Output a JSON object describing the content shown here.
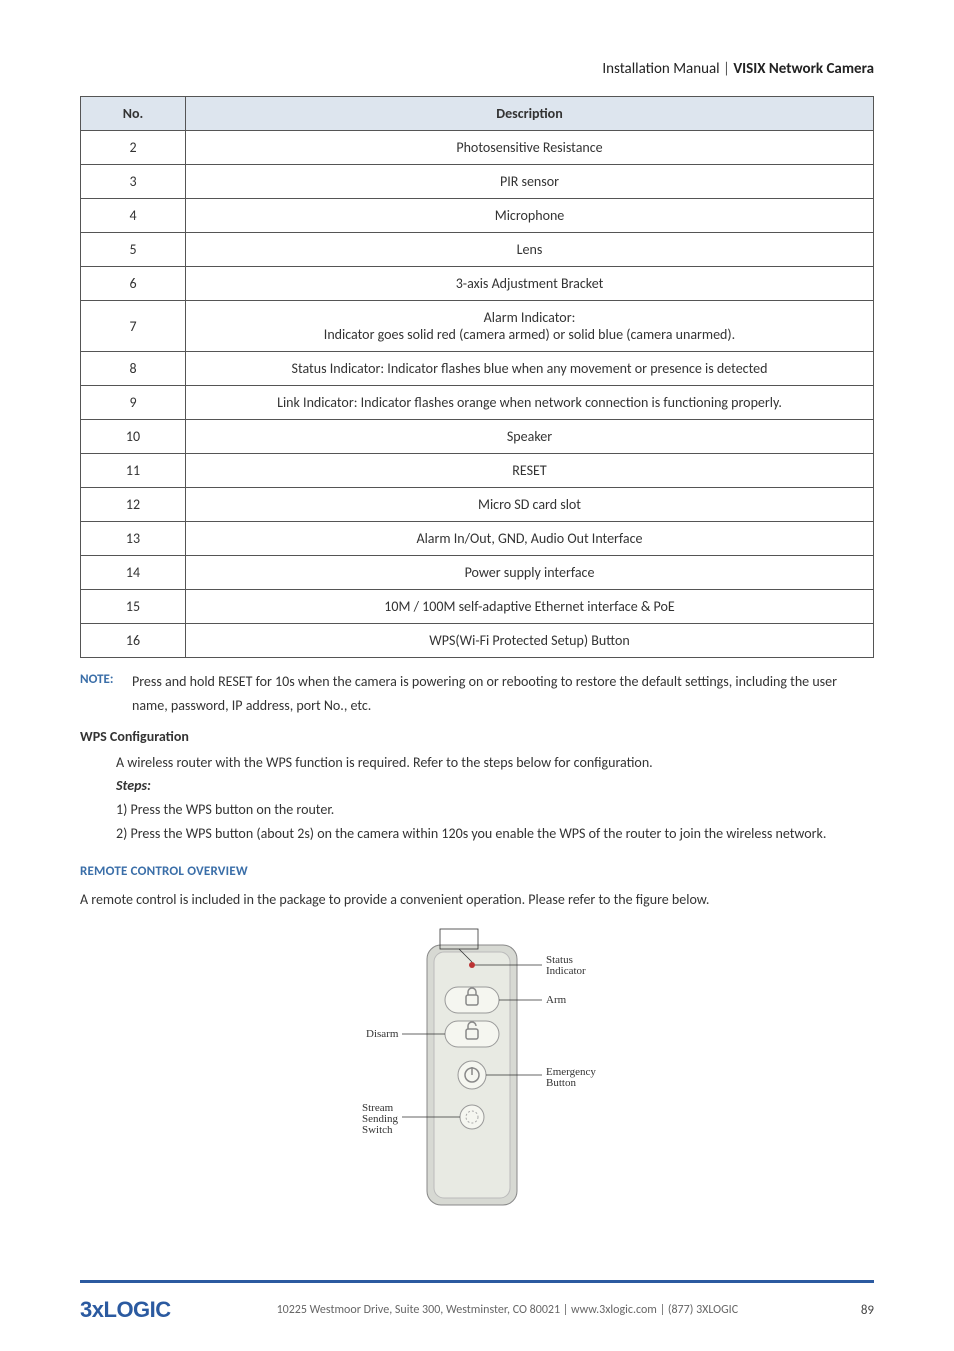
{
  "header": {
    "left": "Installation Manual",
    "divider": " | ",
    "right": "VISIX Network Camera"
  },
  "table": {
    "headers": {
      "no": "No.",
      "desc": "Description"
    },
    "rows": [
      {
        "no": "2",
        "desc": "Photosensitive Resistance"
      },
      {
        "no": "3",
        "desc": "PIR sensor"
      },
      {
        "no": "4",
        "desc": "Microphone"
      },
      {
        "no": "5",
        "desc": "Lens"
      },
      {
        "no": "6",
        "desc": "3-axis Adjustment Bracket"
      },
      {
        "no": "7",
        "desc": "Alarm Indicator:\nIndicator goes solid red (camera armed) or solid blue (camera unarmed)."
      },
      {
        "no": "8",
        "desc": "Status Indicator: Indicator flashes blue when any movement or presence is detected"
      },
      {
        "no": "9",
        "desc": "Link Indicator: Indicator flashes orange when network connection is functioning properly."
      },
      {
        "no": "10",
        "desc": "Speaker"
      },
      {
        "no": "11",
        "desc": "RESET"
      },
      {
        "no": "12",
        "desc": "Micro SD card slot"
      },
      {
        "no": "13",
        "desc": "Alarm In/Out, GND, Audio Out Interface"
      },
      {
        "no": "14",
        "desc": "Power supply interface"
      },
      {
        "no": "15",
        "desc": "10M / 100M self-adaptive Ethernet interface & PoE"
      },
      {
        "no": "16",
        "desc": "WPS(Wi-Fi Protected Setup) Button"
      }
    ]
  },
  "note": {
    "label": "NOTE:",
    "text": "Press and hold RESET for 10s when the camera is powering on or rebooting to restore the default settings, including the user name, password, IP address, port No., etc."
  },
  "wps": {
    "heading": "WPS Configuration",
    "intro": "A wireless router with the WPS function is required. Refer to the steps below for configuration.",
    "steps_label": "Steps:",
    "step1": "1)   Press the WPS button on the router.",
    "step2": "2)   Press the WPS button (about 2s) on the camera within 120s you enable the WPS of the router to join the wireless network."
  },
  "remote": {
    "heading": "REMOTE CONTROL OVERVIEW",
    "intro": "A remote control is included in the package to provide a convenient operation. Please refer to the figure below.",
    "labels": {
      "status": "Status\nIndicator",
      "arm": "Arm",
      "disarm": "Disarm",
      "emergency": "Emergency\nButton",
      "stream": "Stream\nSending\nSwitch"
    }
  },
  "footer": {
    "logo_left": "3",
    "logo_x": "x",
    "logo_right": "LOGIC",
    "address": "10225 Westmoor Drive, Suite 300, Westminster, CO 80021 | www.3xlogic.com | (877) 3XLOGIC",
    "page": "89"
  }
}
